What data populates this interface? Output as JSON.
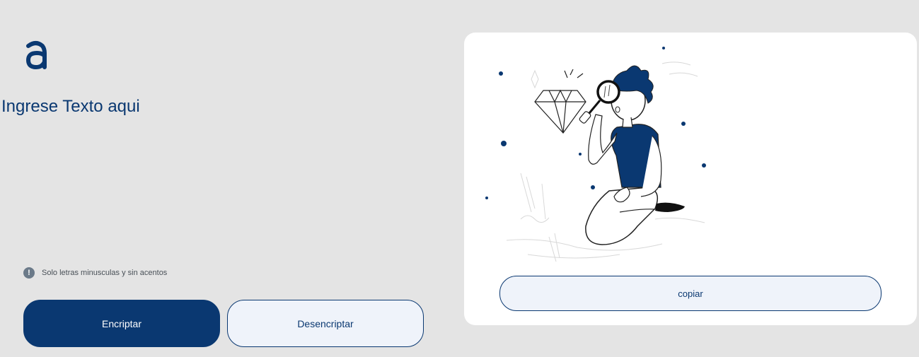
{
  "logo": {
    "icon": "alura-logo-icon",
    "color": "#0a3871"
  },
  "editor": {
    "placeholder": "Ingrese Texto aqui",
    "value": ""
  },
  "hint": {
    "icon": "exclamation-circle-icon",
    "text": "Solo letras minusculas y sin acentos"
  },
  "buttons": {
    "encrypt": "Encriptar",
    "decrypt": "Desencriptar"
  },
  "output": {
    "illustration": "person-with-magnifying-glass-illustration",
    "copy": "copiar"
  },
  "colors": {
    "background": "#e4e4e4",
    "primary": "#0a3871",
    "button_light": "#eff3fa",
    "panel": "#ffffff"
  }
}
